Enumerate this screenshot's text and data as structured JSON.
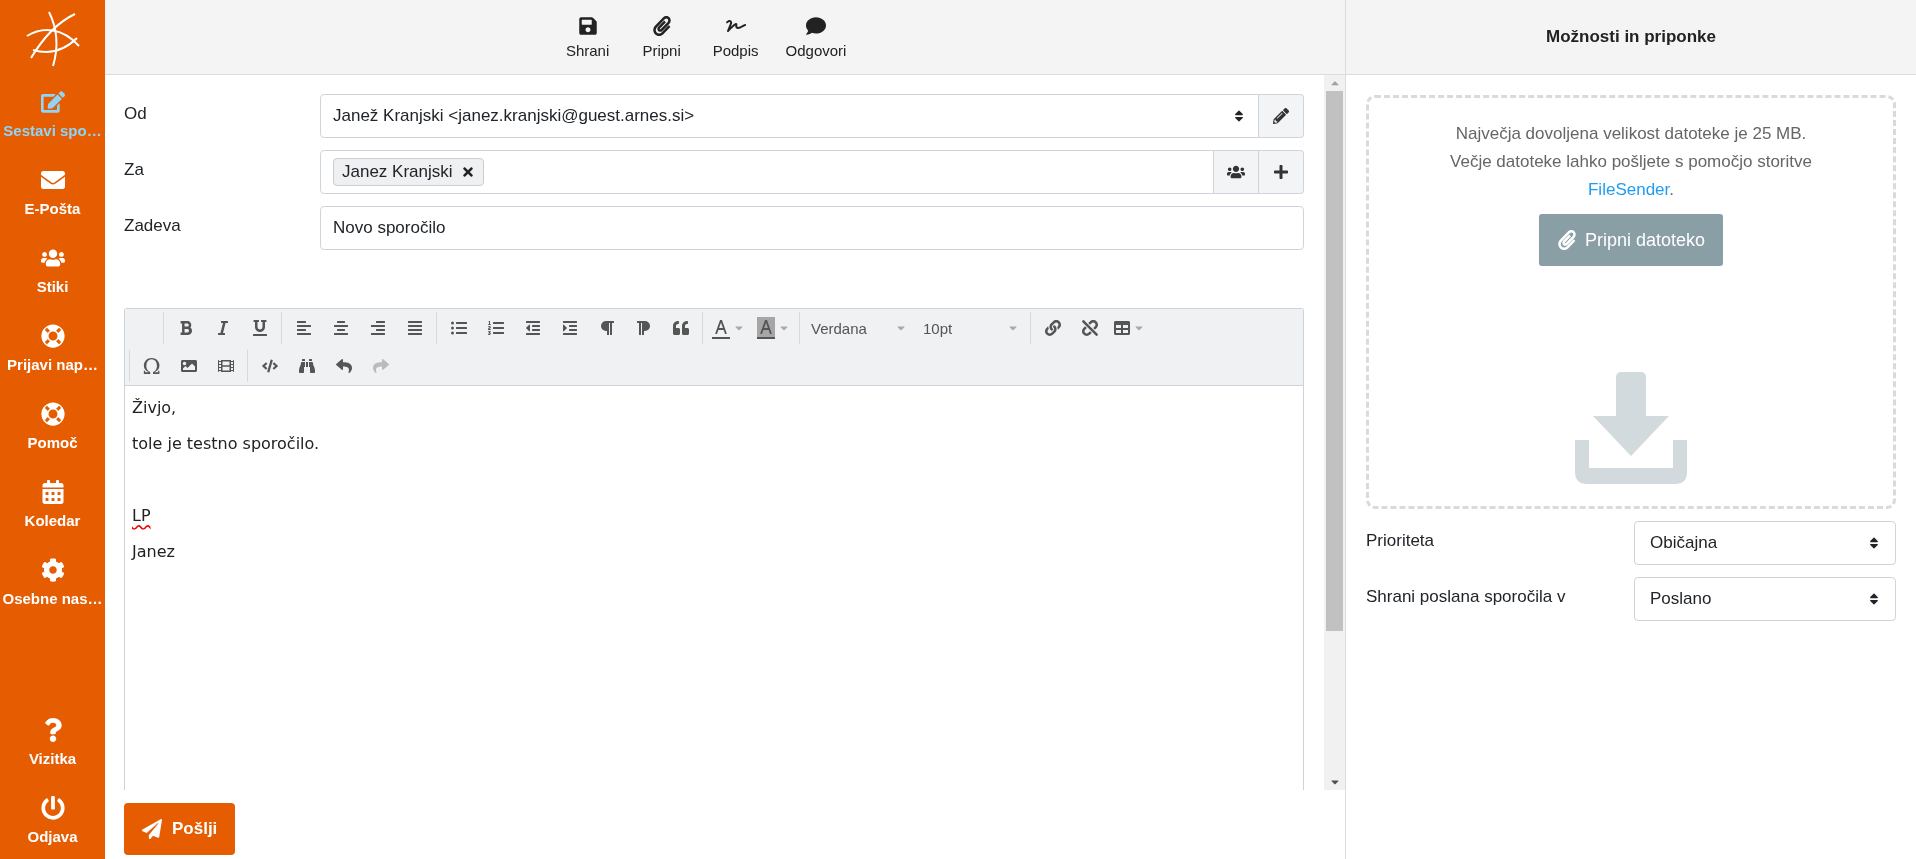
{
  "sidebar": {
    "items": [
      {
        "kind": "compose",
        "label": "Sestavi spo…",
        "selected": true
      },
      {
        "kind": "mail",
        "label": "E-Pošta",
        "selected": false
      },
      {
        "kind": "contacts",
        "label": "Stiki",
        "selected": false
      },
      {
        "kind": "lifering",
        "label": "Prijavi nap…",
        "selected": false
      },
      {
        "kind": "lifering",
        "label": "Pomoč",
        "selected": false
      },
      {
        "kind": "calendar",
        "label": "Koledar",
        "selected": false
      },
      {
        "kind": "settings",
        "label": "Osebne nas…",
        "selected": false
      }
    ],
    "bottom_items": [
      {
        "kind": "help",
        "label": "Vizitka",
        "selected": false
      },
      {
        "kind": "power",
        "label": "Odjava",
        "selected": false
      }
    ]
  },
  "toolbar": {
    "buttons": [
      {
        "kind": "save",
        "label": "Shrani"
      },
      {
        "kind": "attach",
        "label": "Pripni"
      },
      {
        "kind": "signature",
        "label": "Podpis"
      },
      {
        "kind": "reply",
        "label": "Odgovori"
      }
    ]
  },
  "form": {
    "from": {
      "label": "Od",
      "value": "Janež Kranjski <janez.kranjski@guest.arnes.si>"
    },
    "to": {
      "label": "Za",
      "recipients": [
        "Janez Kranjski"
      ]
    },
    "subject": {
      "label": "Zadeva",
      "value": "Novo sporočilo"
    }
  },
  "editor": {
    "toolbar_rows": [
      [
        [
          {
            "kind": "bold",
            "disabled": false
          },
          {
            "kind": "italic",
            "disabled": false
          },
          {
            "kind": "underline",
            "disabled": false
          }
        ],
        [
          {
            "kind": "alignleft",
            "disabled": false
          },
          {
            "kind": "aligncenter",
            "disabled": false
          },
          {
            "kind": "alignright",
            "disabled": false
          },
          {
            "kind": "alignjustify",
            "disabled": false
          }
        ],
        [
          {
            "kind": "bullist",
            "disabled": false
          },
          {
            "kind": "numlist",
            "disabled": false
          },
          {
            "kind": "outdent",
            "disabled": false
          },
          {
            "kind": "indent",
            "disabled": false
          },
          {
            "kind": "ltr",
            "disabled": false
          },
          {
            "kind": "rtl",
            "disabled": false
          },
          {
            "kind": "blockquote",
            "disabled": false
          }
        ],
        [
          {
            "kind": "forecolor",
            "disabled": false
          },
          {
            "kind": "backcolor",
            "disabled": false
          }
        ],
        [
          {
            "kind": "select",
            "value": "Verdana"
          },
          {
            "kind": "select",
            "value": "10pt"
          }
        ],
        [
          {
            "kind": "link",
            "disabled": false
          },
          {
            "kind": "unlink",
            "disabled": false
          },
          {
            "kind": "table",
            "disabled": false
          }
        ]
      ],
      [
        [
          {
            "kind": "charmap",
            "glyph": "Ω",
            "disabled": false
          },
          {
            "kind": "image",
            "disabled": false
          },
          {
            "kind": "media",
            "disabled": false
          }
        ],
        [
          {
            "kind": "code",
            "disabled": false
          },
          {
            "kind": "search",
            "disabled": false
          },
          {
            "kind": "undo",
            "disabled": false
          },
          {
            "kind": "redo",
            "disabled": true
          }
        ]
      ]
    ],
    "body": [
      {
        "kind": "text",
        "text": "Živjo,",
        "misspelled": false
      },
      {
        "kind": "text",
        "text": "tole je testno sporočilo.",
        "misspelled": false
      },
      {
        "kind": "blank"
      },
      {
        "kind": "text",
        "text": "LP",
        "misspelled": true
      },
      {
        "kind": "text",
        "text": "Janez",
        "misspelled": false
      }
    ]
  },
  "send_button": {
    "label": "Pošlji"
  },
  "options_panel": {
    "title": "Možnosti in priponke",
    "upload_info": {
      "line1": "Največja dovoljena velikost datoteke je 25 MB.",
      "line2": "Večje datoteke lahko pošljete s pomočjo storitve",
      "link": "FileSender",
      "after": "."
    },
    "attach_button": "Pripni datoteko",
    "fields": [
      {
        "label": "Prioriteta",
        "value": "Običajna"
      },
      {
        "label": "Shrani poslana sporočila v",
        "value": "Poslano"
      }
    ]
  }
}
